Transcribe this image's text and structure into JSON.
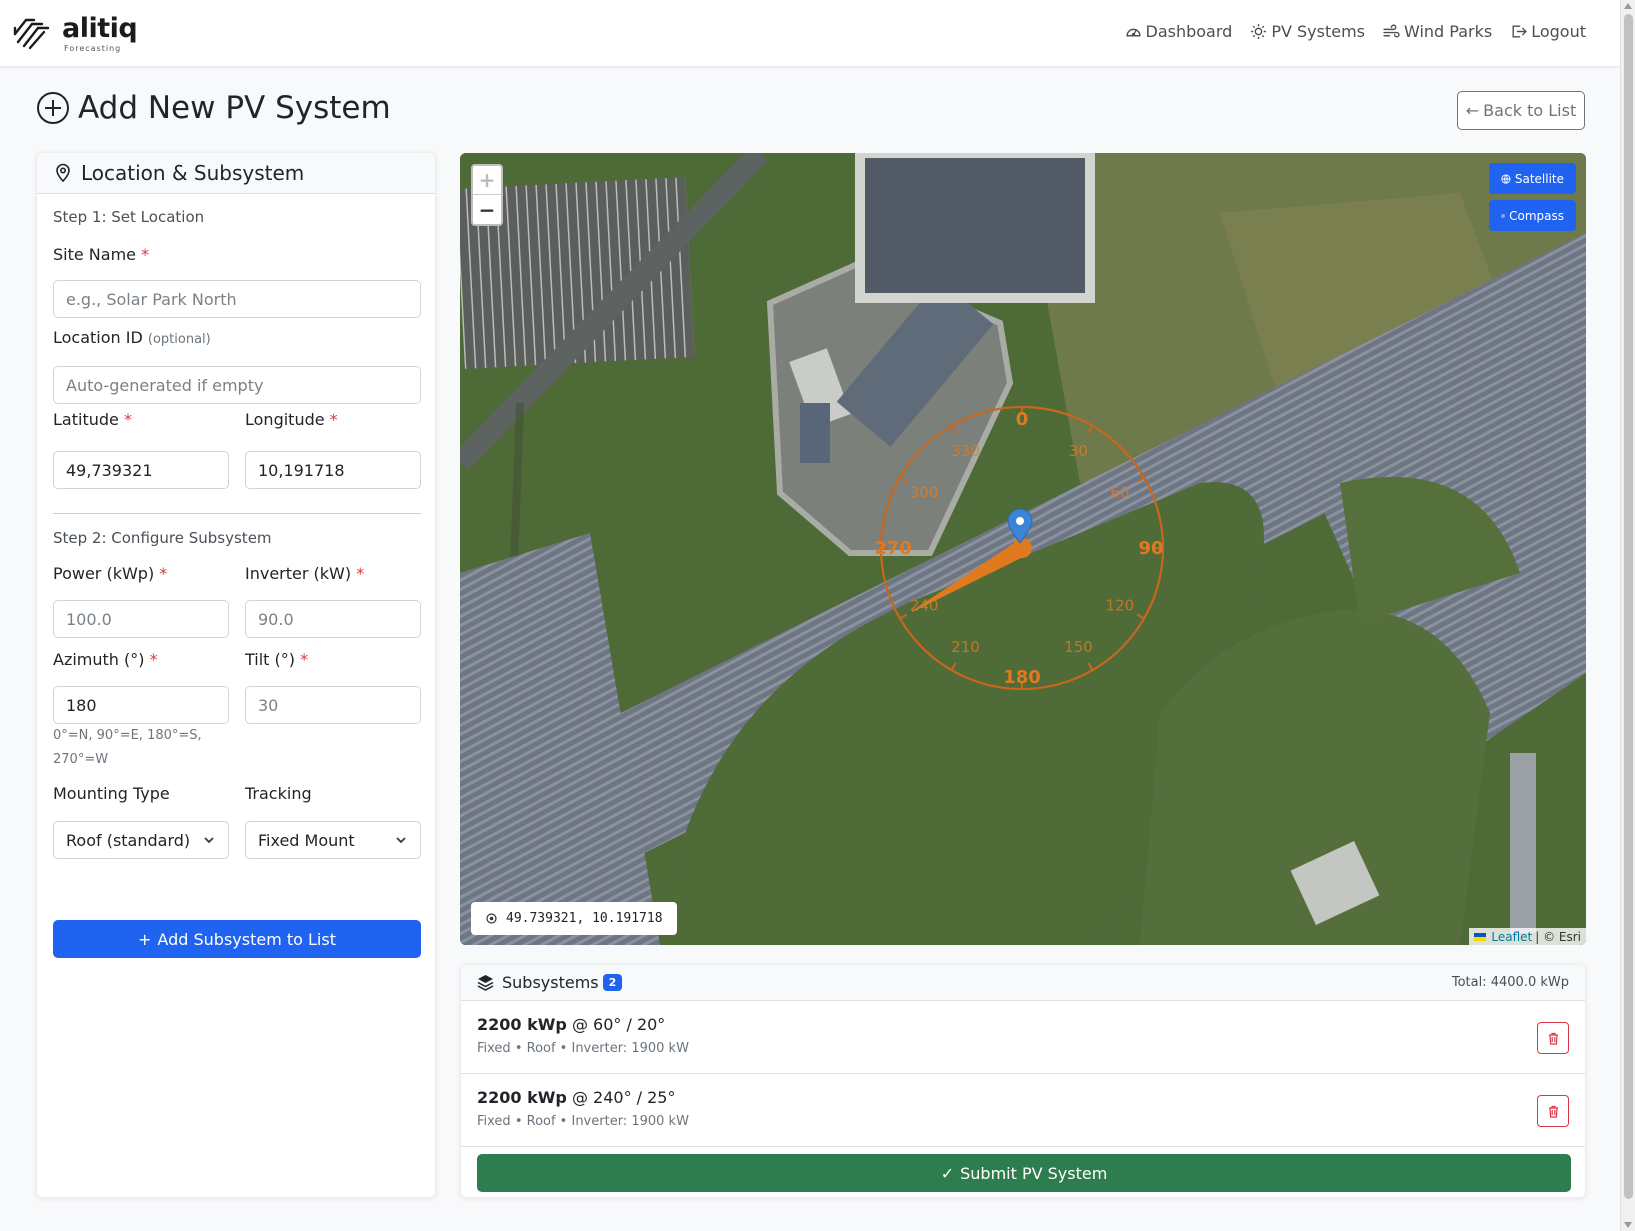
{
  "brand": {
    "name": "alitiq",
    "tagline": "Forecasting"
  },
  "nav": {
    "items": [
      {
        "label": "Dashboard",
        "icon": "speedometer-icon"
      },
      {
        "label": "PV Systems",
        "icon": "sun-icon"
      },
      {
        "label": "Wind Parks",
        "icon": "wind-icon"
      },
      {
        "label": "Logout",
        "icon": "logout-icon"
      }
    ]
  },
  "page": {
    "title": "Add New PV System",
    "back_label": "Back to List"
  },
  "location_card": {
    "title": "Location & Subsystem",
    "step1": "Step 1: Set Location",
    "site_name": {
      "label": "Site Name",
      "required": "*",
      "placeholder": "e.g., Solar Park North",
      "value": ""
    },
    "location_id": {
      "label": "Location ID",
      "optional": "(optional)",
      "placeholder": "Auto-generated if empty",
      "value": ""
    },
    "latitude": {
      "label": "Latitude",
      "required": "*",
      "value": "49,739321"
    },
    "longitude": {
      "label": "Longitude",
      "required": "*",
      "value": "10,191718"
    },
    "step2": "Step 2: Configure Subsystem",
    "power": {
      "label": "Power (kWp)",
      "required": "*",
      "placeholder": "100.0"
    },
    "inverter": {
      "label": "Inverter (kW)",
      "required": "*",
      "placeholder": "90.0"
    },
    "azimuth": {
      "label": "Azimuth (°)",
      "required": "*",
      "value": "180",
      "hint_line1": "0°=N, 90°=E, 180°=S,",
      "hint_line2": "270°=W"
    },
    "tilt": {
      "label": "Tilt (°)",
      "required": "*",
      "placeholder": "30"
    },
    "mounting": {
      "label": "Mounting Type",
      "selected": "Roof (standard)"
    },
    "tracking": {
      "label": "Tracking",
      "selected": "Fixed Mount"
    },
    "add_button": "Add Subsystem to List"
  },
  "map": {
    "zoom_in": "+",
    "zoom_out": "−",
    "satellite_label": "Satellite",
    "compass_label": "Compass",
    "coordinates": "49.739321, 10.191718",
    "attribution_leaflet": "Leaflet",
    "attribution_rest": "| © Esri",
    "compass": {
      "labels": [
        "0",
        "30",
        "60",
        "90",
        "120",
        "150",
        "180",
        "210",
        "240",
        "270",
        "300",
        "330"
      ],
      "azimuth_deg": 240,
      "color": "#e07a1f"
    }
  },
  "subsystems": {
    "title": "Subsystems",
    "count": "2",
    "total": "Total: 4400.0 kWp",
    "items": [
      {
        "power": "2200 kWp",
        "orientation": "@ 60° / 20°",
        "meta": "Fixed • Roof • Inverter: 1900 kW"
      },
      {
        "power": "2200 kWp",
        "orientation": "@ 240° / 25°",
        "meta": "Fixed • Roof • Inverter: 1900 kW"
      }
    ],
    "submit_label": "Submit PV System"
  },
  "colors": {
    "primary": "#1f63f0",
    "success": "#2e7d4f",
    "danger": "#dc3545"
  }
}
